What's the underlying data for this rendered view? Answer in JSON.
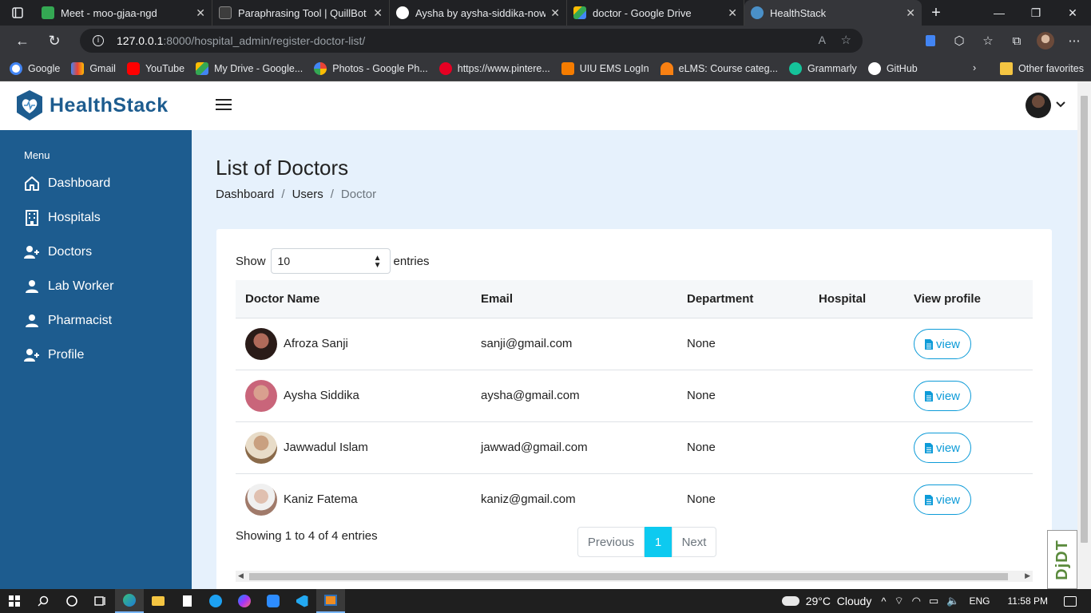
{
  "browser": {
    "tabs": [
      {
        "title": "Meet - moo-gjaa-ngd",
        "color": "#34a853",
        "active": false
      },
      {
        "title": "Paraphrasing Tool | QuillBot AI",
        "color": "#3d3d3d",
        "active": false
      },
      {
        "title": "Aysha by aysha-siddika-nows",
        "color": "#ffffff",
        "active": false
      },
      {
        "title": "doctor - Google Drive",
        "color": "#fbbc04",
        "active": false
      },
      {
        "title": "HealthStack",
        "color": "#4a90c8",
        "active": true
      }
    ],
    "url_host": "127.0.0.1",
    "url_path": ":8000/hospital_admin/register-doctor-list/",
    "bookmarks": [
      {
        "label": "Google",
        "color": "#4285f4"
      },
      {
        "label": "Gmail",
        "color": "#ea4335"
      },
      {
        "label": "YouTube",
        "color": "#ff0000"
      },
      {
        "label": "My Drive - Google...",
        "color": "#fbbc04"
      },
      {
        "label": "Photos - Google Ph...",
        "color": "#34a853"
      },
      {
        "label": "https://www.pintere...",
        "color": "#e60023"
      },
      {
        "label": "UIU EMS LogIn",
        "color": "#f57c00"
      },
      {
        "label": "eLMS: Course categ...",
        "color": "#f98012"
      },
      {
        "label": "Grammarly",
        "color": "#15c39a"
      },
      {
        "label": "GitHub",
        "color": "#ffffff"
      }
    ],
    "other_favorites": "Other favorites"
  },
  "app": {
    "brand": "HealthStack",
    "brand_color": "#1d5c8f",
    "accent_color": "#0d9bd8"
  },
  "sidebar": {
    "menu_label": "Menu",
    "items": [
      {
        "label": "Dashboard",
        "icon": "home-icon"
      },
      {
        "label": "Hospitals",
        "icon": "building-icon"
      },
      {
        "label": "Doctors",
        "icon": "user-plus-icon"
      },
      {
        "label": "Lab Worker",
        "icon": "user-icon"
      },
      {
        "label": "Pharmacist",
        "icon": "user-icon"
      },
      {
        "label": "Profile",
        "icon": "user-plus-icon"
      }
    ]
  },
  "main": {
    "title": "List of Doctors",
    "breadcrumb": [
      "Dashboard",
      "Users",
      "Doctor"
    ],
    "show_label": "Show",
    "entries_label": "entries",
    "page_size": "10",
    "columns": [
      "Doctor Name",
      "Email",
      "Department",
      "Hospital",
      "View profile"
    ],
    "rows": [
      {
        "name": "Afroza Sanji",
        "email": "sanji@gmail.com",
        "department": "None",
        "hospital": "",
        "action": "view"
      },
      {
        "name": "Aysha Siddika",
        "email": "aysha@gmail.com",
        "department": "None",
        "hospital": "",
        "action": "view"
      },
      {
        "name": "Jawwadul Islam",
        "email": "jawwad@gmail.com",
        "department": "None",
        "hospital": "",
        "action": "view"
      },
      {
        "name": "Kaniz Fatema",
        "email": "kaniz@gmail.com",
        "department": "None",
        "hospital": "",
        "action": "view"
      }
    ],
    "info": "Showing 1 to 4 of 4 entries",
    "pagination": {
      "previous": "Previous",
      "current": "1",
      "next": "Next"
    }
  },
  "debug_toolbar": "DjDT",
  "taskbar": {
    "weather": "29°C  Cloudy",
    "language": "ENG",
    "time": "11:58 PM"
  }
}
